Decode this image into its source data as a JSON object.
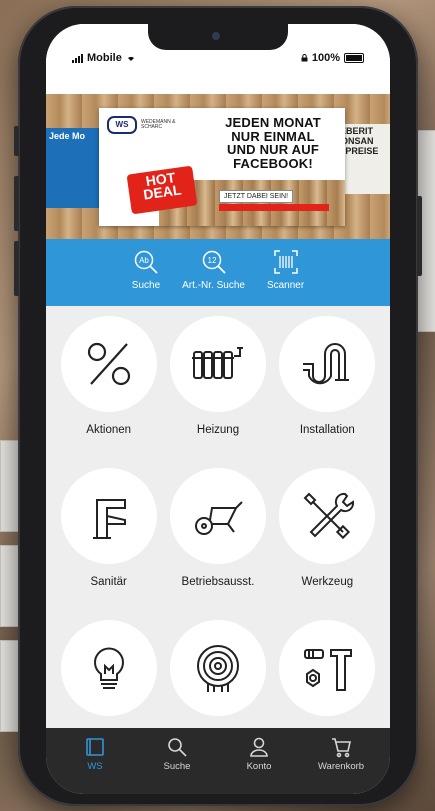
{
  "status": {
    "carrier": "Mobile",
    "battery": "100%"
  },
  "banner": {
    "logo": "WS",
    "brand": "WEDEMANN & SCHARC",
    "headline": "JEDEN MONAT NUR EINMAL UND NUR AUF FACEBOOK!",
    "hot": "HOT DEAL",
    "cta": "JETZT DABEI SEIN!",
    "left_text": "Jede Mo",
    "right_text": "GEBERIT TIONSAN TOPREISE"
  },
  "quick_actions": [
    {
      "label": "Suche",
      "icon": "search-text-icon"
    },
    {
      "label": "Art.-Nr. Suche",
      "icon": "search-number-icon"
    },
    {
      "label": "Scanner",
      "icon": "barcode-scanner-icon"
    }
  ],
  "categories": [
    {
      "label": "Aktionen",
      "icon": "percent-icon"
    },
    {
      "label": "Heizung",
      "icon": "radiator-icon"
    },
    {
      "label": "Installation",
      "icon": "pipe-icon"
    },
    {
      "label": "Sanitär",
      "icon": "faucet-icon"
    },
    {
      "label": "Betriebsausst.",
      "icon": "wheelbarrow-icon"
    },
    {
      "label": "Werkzeug",
      "icon": "tools-icon"
    },
    {
      "label": "",
      "icon": "lightbulb-icon"
    },
    {
      "label": "",
      "icon": "cable-coil-icon"
    },
    {
      "label": "",
      "icon": "fasteners-icon"
    }
  ],
  "tabs": [
    {
      "label": "WS",
      "icon": "ws-book-icon",
      "active": true
    },
    {
      "label": "Suche",
      "icon": "search-icon",
      "active": false
    },
    {
      "label": "Konto",
      "icon": "user-icon",
      "active": false
    },
    {
      "label": "Warenkorb",
      "icon": "cart-icon",
      "active": false
    }
  ],
  "colors": {
    "accent": "#2f96d8",
    "tabbar": "#2a2a2a",
    "hot": "#e2231a"
  }
}
